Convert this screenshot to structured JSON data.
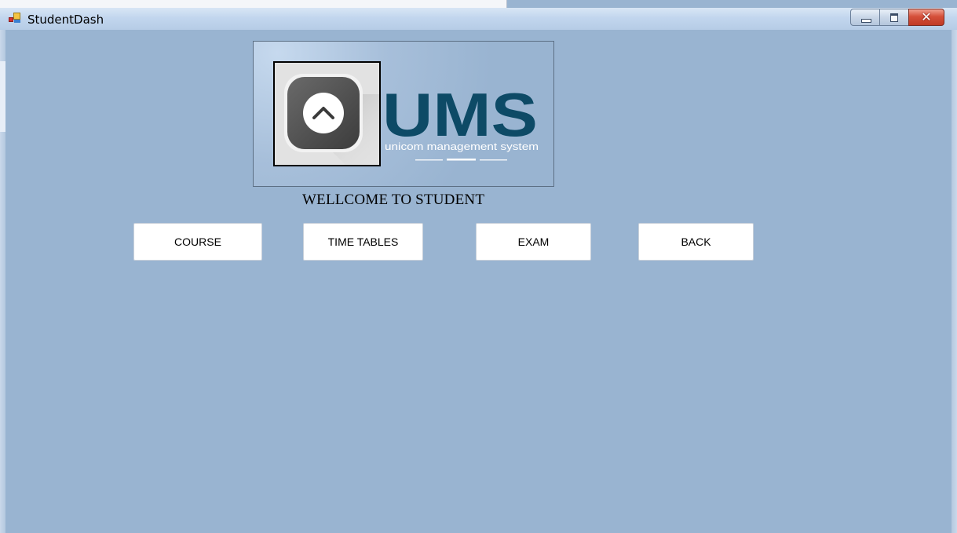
{
  "window": {
    "title": "StudentDash",
    "controls": {
      "minimize_icon": "minimize-icon",
      "maximize_icon": "maximize-icon",
      "close_icon": "close-icon",
      "close_glyph": "✕"
    }
  },
  "logo": {
    "wordmark": "UMS",
    "tagline": "unicom management system",
    "icon": "chevron-up-icon"
  },
  "welcome_text": "WELLCOME TO STUDENT",
  "buttons": {
    "course": "COURSE",
    "timetables": "TIME TABLES",
    "exam": "EXAM",
    "back": "BACK"
  },
  "colors": {
    "background": "#99b4d1",
    "logo_text": "#0d4a66",
    "button_bg": "#ffffff",
    "close_button": "#c9432f"
  }
}
